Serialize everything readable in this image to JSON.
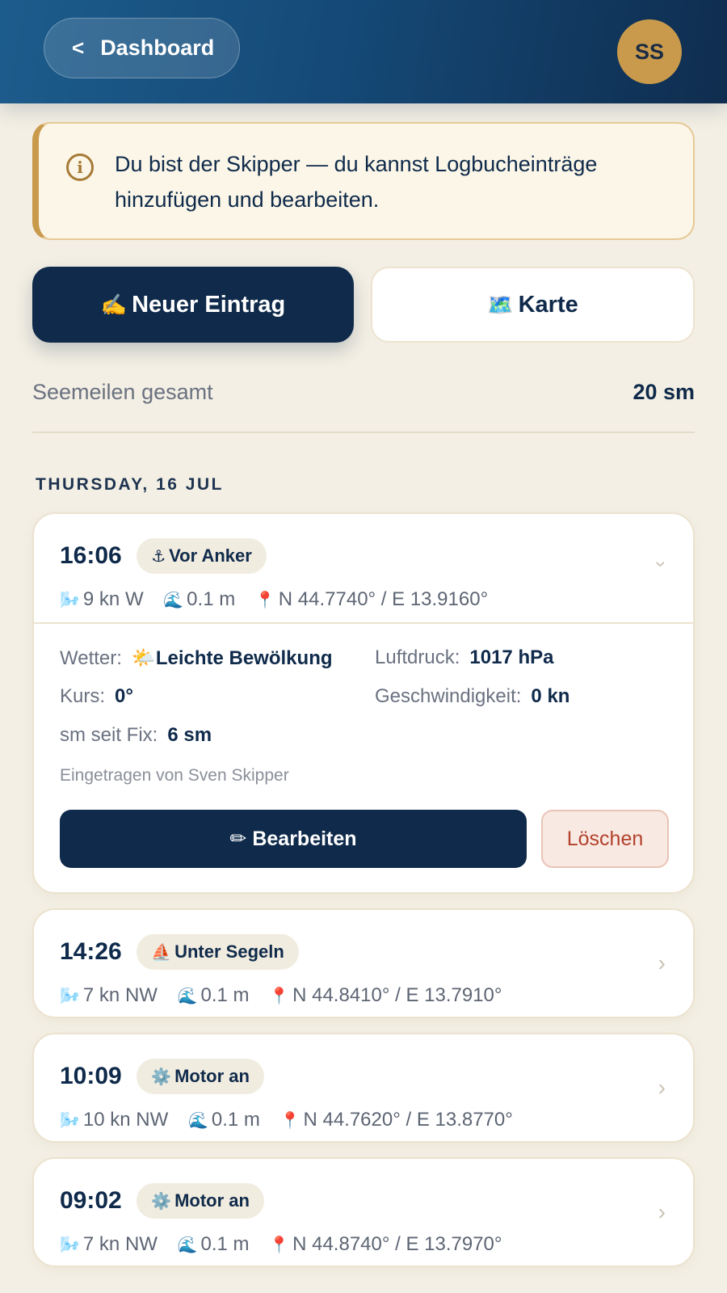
{
  "header": {
    "back_label": "Dashboard",
    "avatar_initials": "SS"
  },
  "notice": {
    "text": "Du bist der Skipper — du kannst Logbucheinträge hinzufügen und bearbeiten."
  },
  "actions": {
    "new_entry_icon": "✍️",
    "new_entry_label": "Neuer Eintrag",
    "map_icon": "🗺️",
    "map_label": "Karte"
  },
  "summary": {
    "label": "Seemeilen gesamt",
    "value": "20 sm"
  },
  "day": {
    "heading": "THURSDAY, 16 JUL"
  },
  "entries": [
    {
      "time": "16:06",
      "status_icon": "⚓",
      "status": "Vor Anker",
      "wind": "9 kn W",
      "waves": "0.1 m",
      "position": "N 44.7740° / E 13.9160°",
      "expanded": true,
      "details": {
        "weather_label": "Wetter:",
        "weather_icon": "🌤️",
        "weather_value": "Leichte Bewölkung",
        "pressure_label": "Luftdruck:",
        "pressure_value": "1017 hPa",
        "course_label": "Kurs:",
        "course_value": "0°",
        "speed_label": "Geschwindigkeit:",
        "speed_value": "0 kn",
        "since_fix_label": "sm seit Fix:",
        "since_fix_value": "6 sm",
        "byline": "Eingetragen von Sven Skipper",
        "edit_label": "✏ Bearbeiten",
        "delete_label": "Löschen"
      }
    },
    {
      "time": "14:26",
      "status_icon": "⛵",
      "status": "Unter Segeln",
      "wind": "7 kn NW",
      "waves": "0.1 m",
      "position": "N 44.8410° / E 13.7910°",
      "expanded": false
    },
    {
      "time": "10:09",
      "status_icon": "⚙️",
      "status": "Motor an",
      "wind": "10 kn NW",
      "waves": "0.1 m",
      "position": "N 44.7620° / E 13.8770°",
      "expanded": false
    },
    {
      "time": "09:02",
      "status_icon": "⚙️",
      "status": "Motor an",
      "wind": "7 kn NW",
      "waves": "0.1 m",
      "position": "N 44.8740° / E 13.7970°",
      "expanded": false
    }
  ],
  "icons": {
    "wind": "🌬️",
    "waves": "🌊",
    "pin": "📍",
    "chevron": "›"
  },
  "colors": {
    "navy": "#0f2a4a",
    "gold": "#c99a4c",
    "background": "#f3efe4",
    "danger": "#b2412b"
  }
}
